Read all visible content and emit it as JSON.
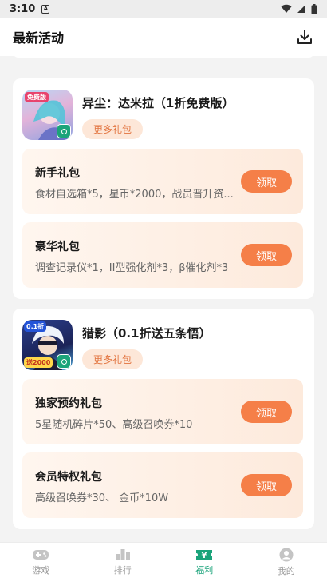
{
  "status_bar": {
    "time": "3:10",
    "sim_icon": "A"
  },
  "header": {
    "title": "最新活动",
    "download_icon": "download-icon"
  },
  "games": [
    {
      "name": "异尘：达米拉（1折免费版）",
      "icon_label": "免费版",
      "more_label": "更多礼包",
      "gifts": [
        {
          "name": "新手礼包",
          "desc": "食材自选箱*5，星币*2000，战员晋升资...",
          "claim": "领取"
        },
        {
          "name": "豪华礼包",
          "desc": "调查记录仪*1，II型强化剂*3，β催化剂*3",
          "claim": "领取"
        }
      ]
    },
    {
      "name": "猎影（0.1折送五条悟）",
      "icon_label_top": "0.1折",
      "icon_label_bottom": "送2000",
      "more_label": "更多礼包",
      "gifts": [
        {
          "name": "独家预约礼包",
          "desc": "5星随机碎片*50、高级召唤券*10",
          "claim": "领取"
        },
        {
          "name": "会员特权礼包",
          "desc": "高级召唤券*30、 金币*10W",
          "claim": "领取"
        }
      ]
    }
  ],
  "tabs": [
    {
      "label": "游戏",
      "icon": "gamepad-icon",
      "active": false
    },
    {
      "label": "排行",
      "icon": "ranking-icon",
      "active": false
    },
    {
      "label": "福利",
      "icon": "welfare-ticket-icon",
      "active": true
    },
    {
      "label": "我的",
      "icon": "profile-icon",
      "active": false
    }
  ],
  "colors": {
    "accent": "#1aa37a",
    "claim_button": "#f57f48",
    "more_text": "#e2733e"
  }
}
